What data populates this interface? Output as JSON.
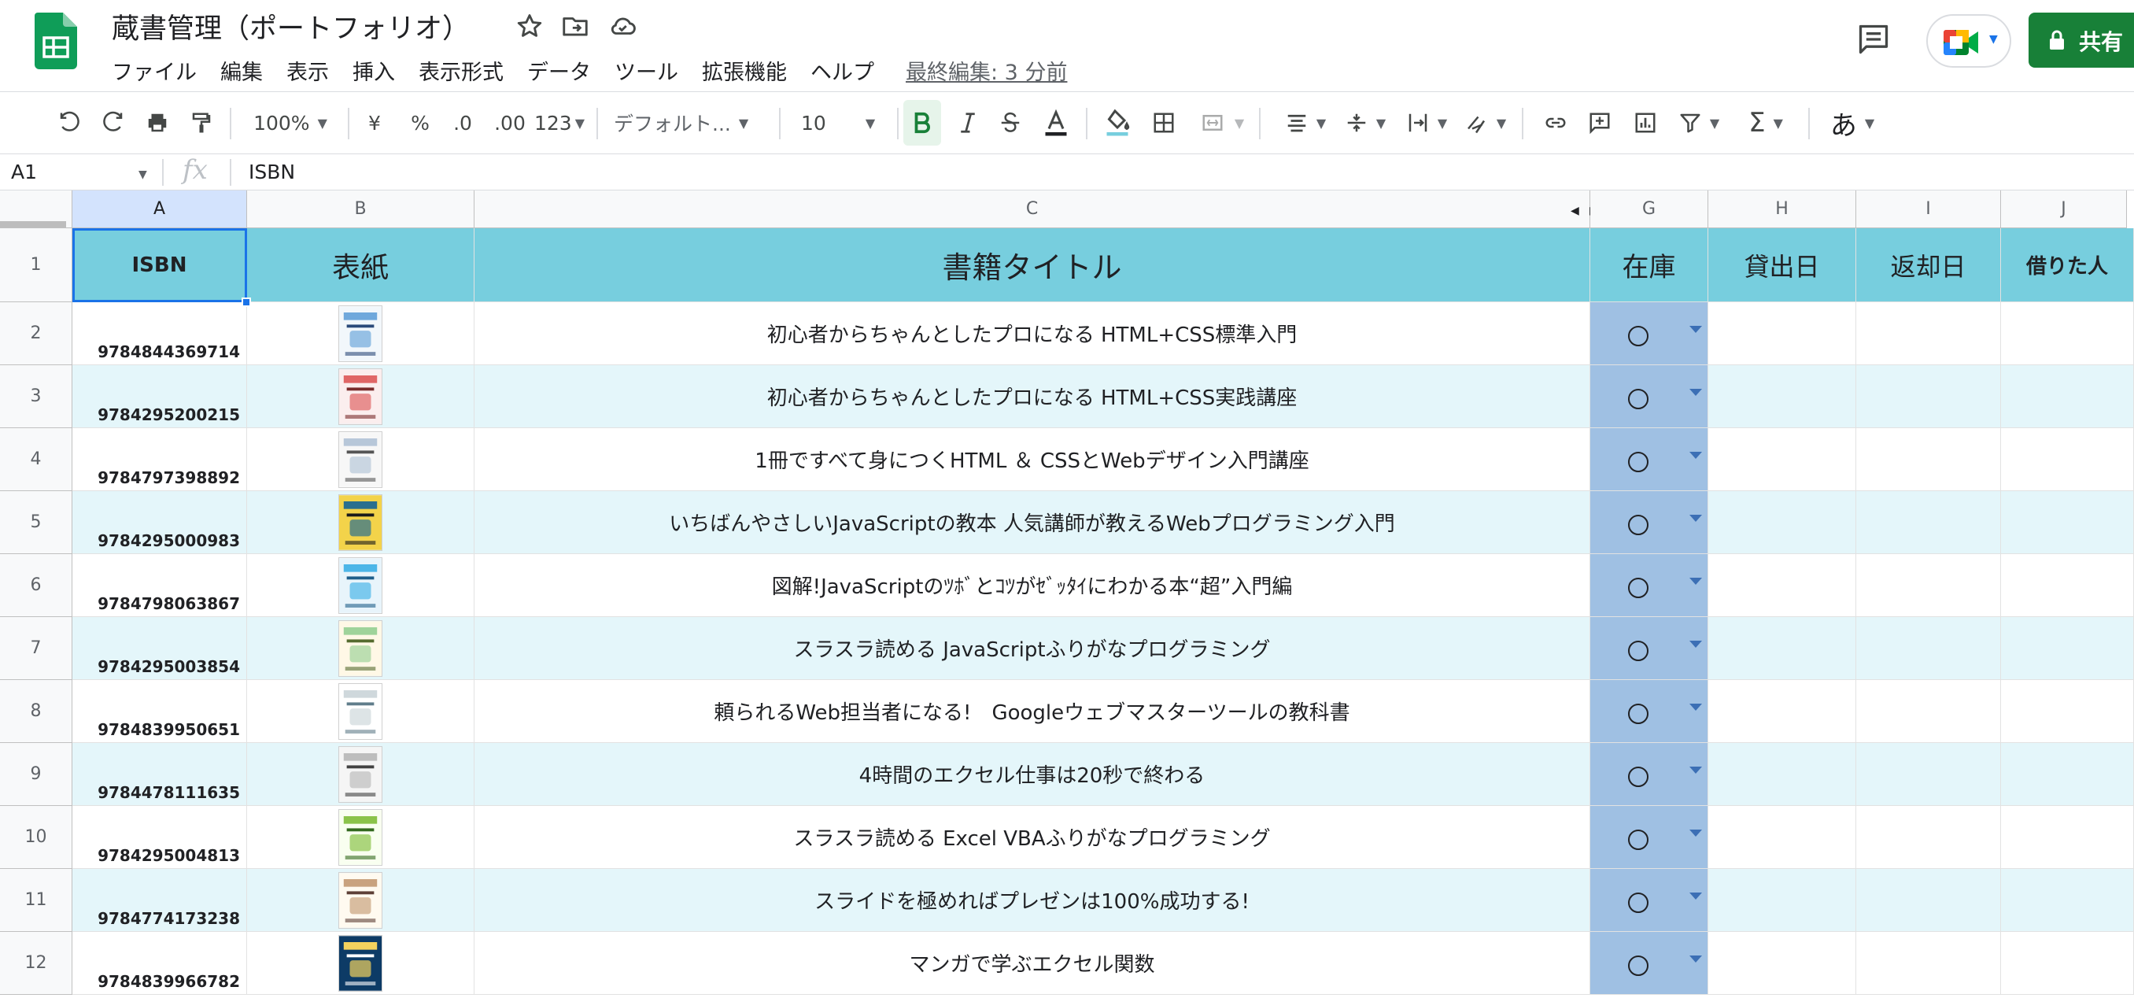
{
  "app": {
    "title": "蔵書管理（ポートフォリオ）",
    "menus": [
      "ファイル",
      "編集",
      "表示",
      "挿入",
      "表示形式",
      "データ",
      "ツール",
      "拡張機能",
      "ヘルプ"
    ],
    "last_edit": "最終編集: 3 分前",
    "share_label": "共有",
    "brand_color": "#188038"
  },
  "toolbar": {
    "zoom": "100%",
    "currency": "¥",
    "percent": "%",
    "dec_less": ".0",
    "dec_more": ".00",
    "more_formats": "123",
    "font": "デフォルト...",
    "font_size": "10",
    "input_tool": "あ"
  },
  "formula_bar": {
    "cell_ref": "A1",
    "fx": "fx",
    "value": "ISBN"
  },
  "columns": [
    "A",
    "B",
    "C",
    "G",
    "H",
    "I",
    "J"
  ],
  "header_row": {
    "row_no": "1",
    "isbn": "ISBN",
    "cover": "表紙",
    "title": "書籍タイトル",
    "stock": "在庫",
    "loan_date": "貸出日",
    "return_date": "返却日",
    "borrower": "借りた人",
    "fill_color": "#77cede"
  },
  "rows": [
    {
      "no": "2",
      "isbn": "9784844369714",
      "title": "初心者からちゃんとしたプロになる HTML+CSS標準入門",
      "stock": "○"
    },
    {
      "no": "3",
      "isbn": "9784295200215",
      "title": "初心者からちゃんとしたプロになる HTML+CSS実践講座",
      "stock": "○"
    },
    {
      "no": "4",
      "isbn": "9784797398892",
      "title": "1冊ですべて身につくHTML ＆ CSSとWebデザイン入門講座",
      "stock": "○"
    },
    {
      "no": "5",
      "isbn": "9784295000983",
      "title": "いちばんやさしいJavaScriptの教本 人気講師が教えるWebプログラミング入門",
      "stock": "○"
    },
    {
      "no": "6",
      "isbn": "9784798063867",
      "title": "図解!JavaScriptのﾂﾎﾞとｺﾂがｾﾞｯﾀｲにわかる本“超”入門編",
      "stock": "○"
    },
    {
      "no": "7",
      "isbn": "9784295003854",
      "title": "スラスラ読める JavaScriptふりがなプログラミング",
      "stock": "○"
    },
    {
      "no": "8",
      "isbn": "9784839950651",
      "title": "頼られるWeb担当者になる!　Googleウェブマスターツールの教科書",
      "stock": "○"
    },
    {
      "no": "9",
      "isbn": "9784478111635",
      "title": "4時間のエクセル仕事は20秒で終わる",
      "stock": "○"
    },
    {
      "no": "10",
      "isbn": "9784295004813",
      "title": "スラスラ読める Excel VBAふりがなプログラミング",
      "stock": "○"
    },
    {
      "no": "11",
      "isbn": "9784774173238",
      "title": "スライドを極めればプレゼンは100%成功する!",
      "stock": "○"
    },
    {
      "no": "12",
      "isbn": "9784839966782",
      "title": "マンガで学ぶエクセル関数",
      "stock": "○"
    }
  ],
  "colors": {
    "stripe": "#e4f6fa",
    "stock_column": "#9fc0e3",
    "selection": "#1a73e8"
  }
}
